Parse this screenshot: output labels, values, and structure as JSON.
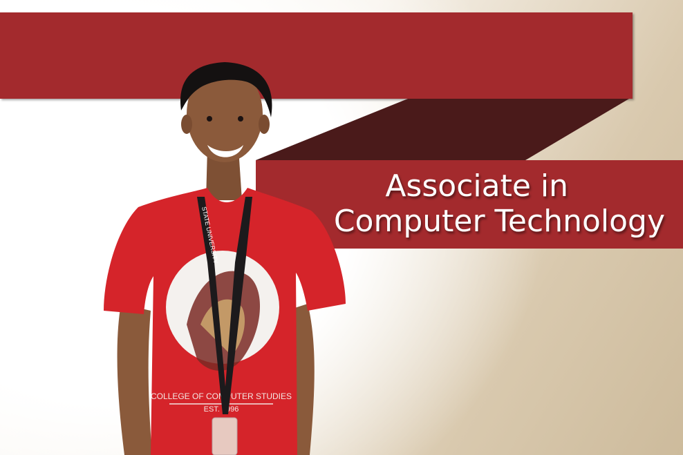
{
  "banner": {
    "title_line1": "Associate in",
    "title_line2": "Computer Technology"
  },
  "shirt": {
    "line1": "COLLEGE OF COMPUTER STUDIES",
    "line2": "EST. 1996"
  },
  "lanyard": {
    "text": "STATE UNIVERSITY"
  },
  "colors": {
    "brand_red": "#a32a2d",
    "dark_maroon": "#4a1a1a",
    "beige": "#cdbb9c"
  }
}
